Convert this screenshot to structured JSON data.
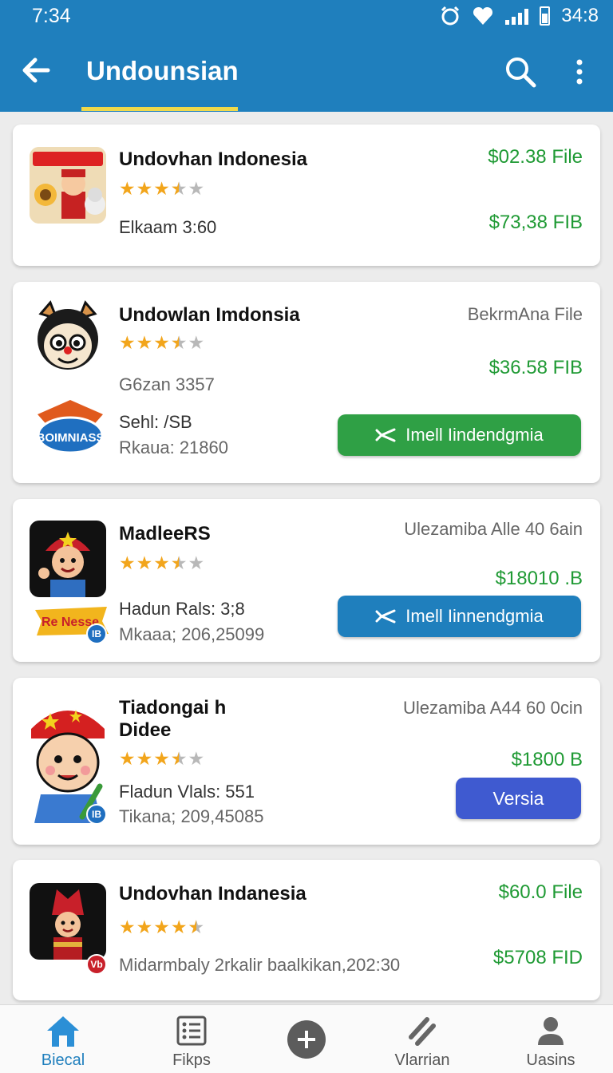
{
  "status_bar": {
    "time": "7:34",
    "clock": "34:8"
  },
  "app_bar": {
    "title": "Undounsian"
  },
  "cards": [
    {
      "name": "Undovhan Indonesia",
      "rating": 3.5,
      "meta_1": "Elkaam 3:60",
      "price_1": "$02.38 File",
      "price_2": "$73,38 FIB"
    },
    {
      "name": "Undowlan Imdonsia",
      "rating": 3.5,
      "meta_1": "G6zan 3357",
      "meta_2": "Sehl: /SB",
      "meta_3": "Rkaua: 21860",
      "label": "BekrmAna File",
      "price_1": "$36.58 FIB",
      "button": "Imell Iindendgmia",
      "logo_text": "BOIMNIASS"
    },
    {
      "name": "MadleeRS",
      "rating": 3.5,
      "meta_1": "Hadun Rals: 3;8",
      "meta_2": "Mkaaa; 206,25099",
      "label": "Ulezamiba Alle 40 6ain",
      "price_1": "$18010 .B",
      "button": "Imell Iinnendgmia",
      "sticker": "Re Nesse",
      "badge": "IB"
    },
    {
      "name_line_1": "Tiadongai h",
      "name_line_2": "Didee",
      "rating": 3.5,
      "meta_1": "Fladun Vlals: 551",
      "meta_2": "Tikana; 209,45085",
      "label": "Ulezamiba A44 60 0cin",
      "price_1": "$1800 B",
      "button": "Versia",
      "badge": "IB"
    },
    {
      "name": "Undovhan Indanesia",
      "rating": 4.5,
      "meta_1": "Midarmbaly 2rkalir baalkikan,202:30",
      "price_1": "$60.0 File",
      "price_2": "$5708 FID",
      "badge": "Vb"
    }
  ],
  "bottom_nav": [
    {
      "label": "Biecal",
      "icon": "home-icon",
      "active": true
    },
    {
      "label": "Fikps",
      "icon": "list-icon",
      "active": false
    },
    {
      "label": "",
      "icon": "add-icon",
      "active": false
    },
    {
      "label": "Vlarrian",
      "icon": "slashes-icon",
      "active": false
    },
    {
      "label": "Uasins",
      "icon": "person-icon",
      "active": false
    }
  ],
  "colors": {
    "primary": "#1f7fbd",
    "accent_underline": "#f0d94a",
    "price_green": "#1f9a34",
    "button_green": "#2fa045",
    "button_indigo": "#3f5ad0",
    "star": "#f2a51b"
  }
}
